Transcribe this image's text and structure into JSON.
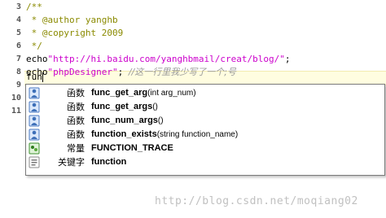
{
  "editor": {
    "lines": [
      {
        "num": "3",
        "text": "/**"
      },
      {
        "num": "4",
        "text": " * @author yanghb"
      },
      {
        "num": "5",
        "text": " * @copyright 2009"
      },
      {
        "num": "6",
        "text": " */"
      },
      {
        "num": "7",
        "echo": "echo",
        "str": "\"http://hi.baidu.com/yanghbmail/creat/blog/\"",
        "end": ";"
      },
      {
        "num": "8",
        "echo": "echo",
        "str": "\"phpDesigner\"",
        "mid": "; ",
        "comment": "//这一行里我少写了一个;号"
      },
      {
        "num": "9",
        "text": "fun"
      },
      {
        "num": "10",
        "text": ""
      },
      {
        "num": "11",
        "text": ""
      }
    ]
  },
  "autocomplete": {
    "items": [
      {
        "type": "函数",
        "name": "func_get_arg",
        "params": "(int arg_num)",
        "icon": "function-icon"
      },
      {
        "type": "函数",
        "name": "func_get_args",
        "params": "()",
        "icon": "function-icon"
      },
      {
        "type": "函数",
        "name": "func_num_args",
        "params": "()",
        "icon": "function-icon"
      },
      {
        "type": "函数",
        "name": "function_exists",
        "params": "(string function_name)",
        "icon": "function-icon"
      },
      {
        "type": "常量",
        "name": "FUNCTION_TRACE",
        "params": "",
        "icon": "constant-icon"
      },
      {
        "type": "关键字",
        "name": "function",
        "params": "",
        "icon": "keyword-icon"
      }
    ]
  },
  "watermark": "http://blog.csdn.net/moqiang02"
}
